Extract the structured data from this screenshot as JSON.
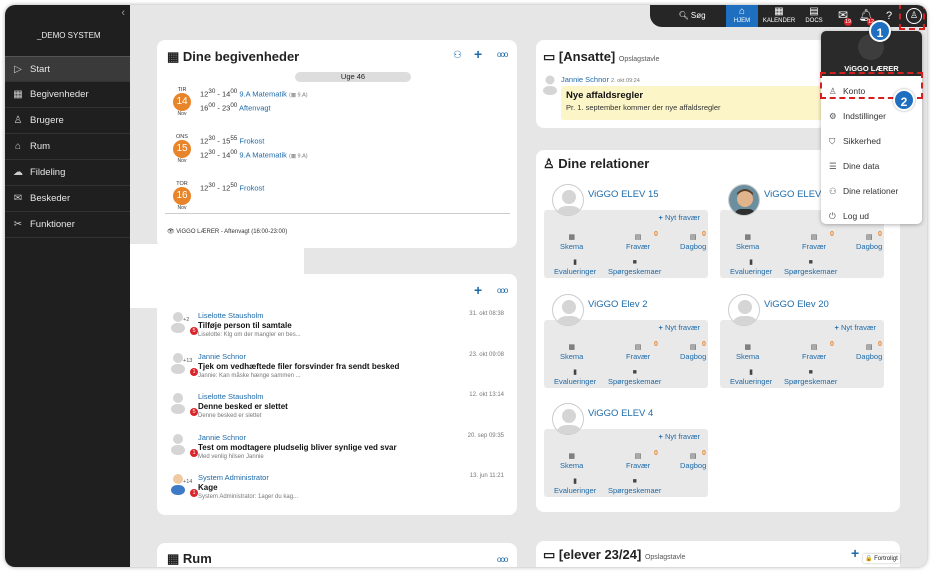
{
  "sidebar": {
    "org": "_DEMO SYSTEM",
    "items": [
      {
        "label": "Start",
        "icon": "play-icon"
      },
      {
        "label": "Begivenheder",
        "icon": "calendar-icon"
      },
      {
        "label": "Brugere",
        "icon": "users-icon"
      },
      {
        "label": "Rum",
        "icon": "room-icon"
      },
      {
        "label": "Fildeling",
        "icon": "cloud-icon"
      },
      {
        "label": "Beskeder",
        "icon": "chat-icon"
      },
      {
        "label": "Funktioner",
        "icon": "tools-icon"
      }
    ]
  },
  "topbar": {
    "search": "Søg",
    "home": "HJEM",
    "calendar": "KALENDER",
    "docs": "DOCS",
    "mail_badge": "19",
    "notif_badge": "12"
  },
  "events": {
    "title": "Dine begivenheder",
    "week": "Uge 46",
    "days": [
      {
        "wd": "TIR",
        "num": "14",
        "mo": "Nov",
        "items": [
          {
            "time_from": "12",
            "time_from_sup": "30",
            "time_to": "14",
            "time_to_sup": "00",
            "title": "9.A Matematik",
            "room": "(▦ 9.A)"
          },
          {
            "time_from": "16",
            "time_from_sup": "00",
            "time_to": "23",
            "time_to_sup": "00",
            "title": "Aftenvagt",
            "room": ""
          }
        ]
      },
      {
        "wd": "ONS",
        "num": "15",
        "mo": "Nov",
        "items": [
          {
            "time_from": "12",
            "time_from_sup": "30",
            "time_to": "15",
            "time_to_sup": "55",
            "title": "Frokost",
            "room": ""
          },
          {
            "time_from": "12",
            "time_from_sup": "30",
            "time_to": "14",
            "time_to_sup": "00",
            "title": "9.A Matematik",
            "room": "(▦ 9.A)"
          }
        ]
      },
      {
        "wd": "TOR",
        "num": "16",
        "mo": "Nov",
        "items": [
          {
            "time_from": "12",
            "time_from_sup": "30",
            "time_to": "12",
            "time_to_sup": "50",
            "title": "Frokost",
            "room": ""
          }
        ]
      }
    ],
    "footer": "👁 ViGGO LÆRER - Aftenvagt (16:00-23:00)"
  },
  "messages": [
    {
      "from": "Liselotte Stausholm",
      "subject": "Tilføje person til samtale",
      "preview": "Liselotte: Klg om der mangler en bes...",
      "date": "31. okt 08:38",
      "count": "+2",
      "badge": "5"
    },
    {
      "from": "Jannie Schnor",
      "subject": "Tjek om vedhæftede filer forsvinder fra sendt besked",
      "preview": "Jannie: Kan måske hænge sammen ...",
      "date": "23. okt 09:08",
      "count": "+13",
      "badge": "1"
    },
    {
      "from": "Liselotte Stausholm",
      "subject": "Denne besked er slettet",
      "preview": "Denne besked er slettet",
      "date": "12. okt 13:14",
      "count": "",
      "badge": "5"
    },
    {
      "from": "Jannie Schnor",
      "subject": "Test om modtagere pludselig bliver synlige ved svar",
      "preview": "Med venlig hilsen Jannie",
      "date": "20. sep 09:35",
      "count": "",
      "badge": "1"
    },
    {
      "from": "System Administrator",
      "subject": "Kage",
      "preview": "System Administrator: 1ager du kag...",
      "date": "13. jun 11:21",
      "count": "+14",
      "badge": "1"
    }
  ],
  "rum": {
    "title": "Rum"
  },
  "ansatte": {
    "title": "[Ansatte]",
    "subtitle": "Opslagstavle",
    "post_author": "Jannie Schnor",
    "post_date": "2. okt 09:24",
    "post_title": "Nye affaldsregler",
    "post_body": "Pr. 1. september kommer der nye affaldsregler"
  },
  "relations": {
    "title": "Dine relationer",
    "new_absence": "Nyt fravær",
    "links": {
      "skema": "Skema",
      "fravaer": "Fravær",
      "dagbog": "Dagbog",
      "evalueringer": "Evalueringer",
      "sporgeskemaer": "Spørgeskemaer"
    },
    "students": [
      {
        "name": "ViGGO ELEV 15",
        "fravaer_count": "0",
        "dagbog_count": "0"
      },
      {
        "name": "ViGGO ELEV",
        "fravaer_count": "0",
        "dagbog_count": "0"
      },
      {
        "name": "ViGGO Elev 2",
        "fravaer_count": "0",
        "dagbog_count": "0"
      },
      {
        "name": "ViGGO Elev 20",
        "fravaer_count": "0",
        "dagbog_count": "0"
      },
      {
        "name": "ViGGO ELEV 4",
        "fravaer_count": "0",
        "dagbog_count": "0"
      }
    ]
  },
  "elever": {
    "title": "[elever 23/24]",
    "subtitle": "Opslagstavle",
    "tag": "🔒 Fortroligt"
  },
  "user_menu": {
    "name": "ViGGO LÆRER",
    "items": [
      {
        "label": "Konto",
        "icon": "user-icon"
      },
      {
        "label": "Indstillinger",
        "icon": "gear-icon"
      },
      {
        "label": "Sikkerhed",
        "icon": "shield-icon"
      },
      {
        "label": "Dine data",
        "icon": "database-icon"
      },
      {
        "label": "Dine relationer",
        "icon": "relations-icon"
      },
      {
        "label": "Log ud",
        "icon": "power-icon"
      }
    ]
  },
  "callouts": {
    "one": "1",
    "two": "2"
  },
  "colors": {
    "accent": "#1e6aa8",
    "orange": "#e8852a",
    "red": "#d9252a",
    "sidebar": "#1f1f1f"
  }
}
